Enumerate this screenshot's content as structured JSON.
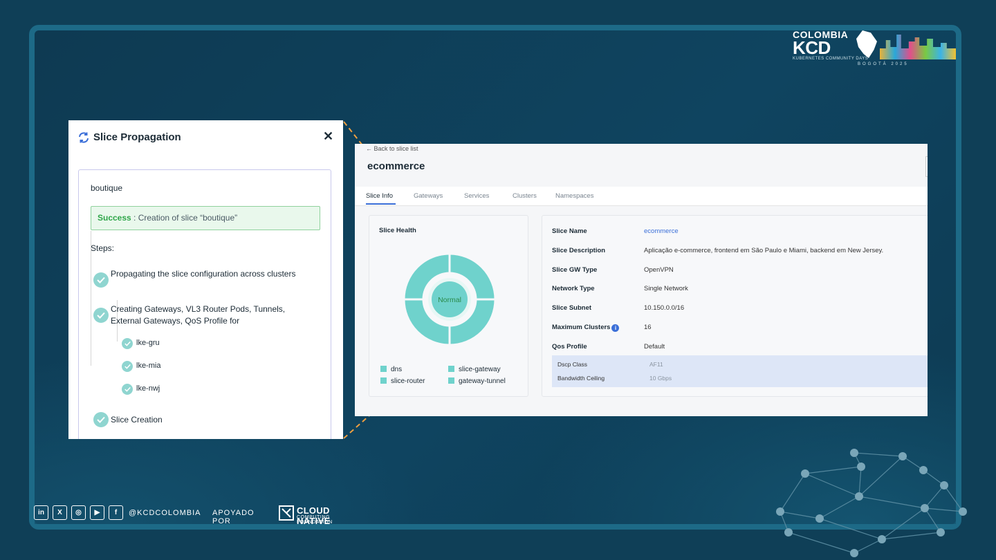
{
  "brand": {
    "line1": "COLOMBIA",
    "line2": "KCD",
    "tagline": "KUBERNETES COMMUNITY DAYS",
    "city": "BOGOTÁ 2025"
  },
  "panel": {
    "title": "Slice Propagation",
    "close": "✕",
    "slice_name": "boutique",
    "success_label": "Success",
    "success_text": " : Creation of slice “boutique”",
    "steps_label": "Steps:",
    "steps": [
      "Propagating the slice configuration across clusters",
      "Creating Gateways, VL3 Router Pods, Tunnels, External Gateways, QoS Profile for",
      "Slice Creation"
    ],
    "clusters": [
      "lke-gru",
      "lke-mia",
      "lke-nwj"
    ]
  },
  "detail": {
    "back": "Back to slice list",
    "title": "ecommerce",
    "tabs": [
      "Slice Info",
      "Gateways",
      "Services",
      "Clusters",
      "Namespaces"
    ],
    "health": {
      "title": "Slice Health",
      "status": "Normal",
      "legend": [
        "dns",
        "slice-gateway",
        "slice-router",
        "gateway-tunnel"
      ]
    },
    "fields": [
      {
        "label": "Slice Name",
        "value": "ecommerce"
      },
      {
        "label": "Slice Description",
        "value": "Aplicação e-commerce, frontend em São Paulo e Miami, backend em New Jersey."
      },
      {
        "label": "Slice GW Type",
        "value": "OpenVPN"
      },
      {
        "label": "Network Type",
        "value": "Single Network"
      },
      {
        "label": "Slice Subnet",
        "value": "10.150.0.0/16"
      },
      {
        "label": "Maximum Clusters",
        "value": "16"
      },
      {
        "label": "Qos Profile",
        "value": "Default"
      }
    ],
    "qos": [
      {
        "label": "Dscp Class",
        "value": "AF11"
      },
      {
        "label": "Bandwidth Ceiling",
        "value": "10 Gbps"
      }
    ]
  },
  "footer": {
    "socials": [
      "in",
      "X",
      "◎",
      "▶",
      "f"
    ],
    "handle": "@KCDCOLOMBIA",
    "supported_by": "APOYADO POR",
    "cncf_line1": "CLOUD NATIVE",
    "cncf_line2": "COMPUTING FOUNDATION"
  },
  "colors": {
    "background": "#0f3f57",
    "frame": "#1d6a87",
    "accent": "#3b6fd8",
    "donut": "#6fd2cc",
    "connector": "#f0a040"
  }
}
